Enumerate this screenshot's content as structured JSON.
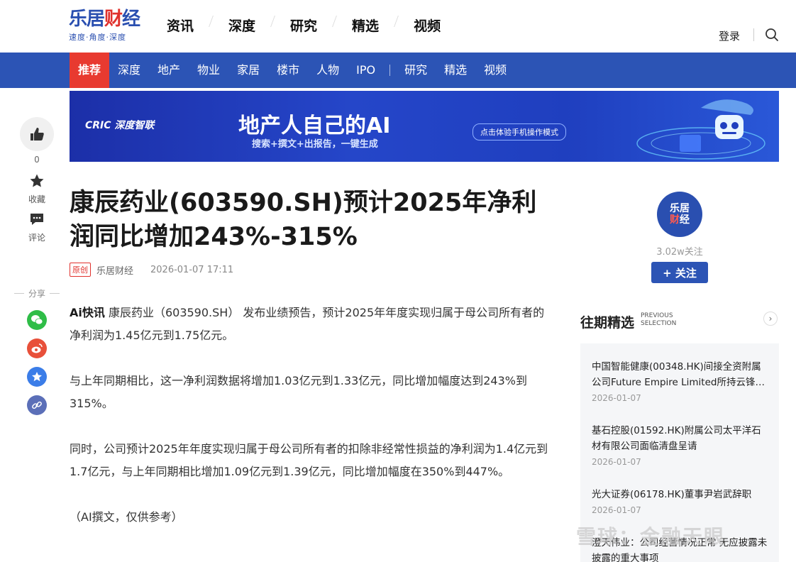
{
  "header": {
    "logo_main_a": "乐居",
    "logo_main_b": "财",
    "logo_main_c": "经",
    "logo_sub": "速度·角度·深度",
    "nav": [
      "资讯",
      "深度",
      "研究",
      "精选",
      "视频"
    ],
    "login": "登录"
  },
  "subnav": {
    "active": "推荐",
    "items_a": [
      "深度",
      "地产",
      "物业",
      "家居",
      "楼市",
      "人物",
      "IPO"
    ],
    "items_b": [
      "研究",
      "精选",
      "视频"
    ]
  },
  "banner": {
    "brand": "CRIC 深度智联",
    "title": "地产人自己的AI",
    "subtitle": "搜索+撰文+出报告，一键生成",
    "cta": "点击体验手机操作模式"
  },
  "rail": {
    "like_count": "0",
    "favorite_label": "收藏",
    "comment_label": "评论",
    "share_label": "分享"
  },
  "article": {
    "title": "康辰药业(603590.SH)预计2025年净利润同比增加243%-315%",
    "tag": "原创",
    "source": "乐居财经",
    "datetime": "2026-01-07 17:11",
    "ai_label": "Ai快讯",
    "p1": " 康辰药业（603590.SH） 发布业绩预告，预计2025年年度实现归属于母公司所有者的净利润为1.45亿元到1.75亿元。",
    "p2": "与上年同期相比，这一净利润数据将增加1.03亿元到1.33亿元，同比增加幅度达到243%到315%。",
    "p3": "同时，公司预计2025年年度实现归属于母公司所有者的扣除非经常性损益的净利润为1.4亿元到1.7亿元，与上年同期相比增加1.09亿元到1.39亿元，同比增加幅度在350%到447%。",
    "p4": "（AI撰文，仅供参考）"
  },
  "author": {
    "avatar_a": "乐居",
    "avatar_b": "财",
    "avatar_c": "经",
    "followers": "3.02w关注",
    "follow_label": "+ 关注"
  },
  "past": {
    "title": "往期精选",
    "en_line1": "PREVIOUS",
    "en_line2": "SELECTION",
    "arrow": "›",
    "items": [
      {
        "title": "中国智能健康(00348.HK)间接全资附属公司Future Empire Limited所持云锋…",
        "date": "2026-01-07"
      },
      {
        "title": "基石控股(01592.HK)附属公司太平洋石材有限公司面临清盘呈请",
        "date": "2026-01-07"
      },
      {
        "title": "光大证券(06178.HK)董事尹岩武辞职",
        "date": "2026-01-07"
      },
      {
        "title": "澄天伟业：公司经营情况正常 无应披露未披露的重大事项",
        "date": ""
      }
    ]
  },
  "watermark": "雪球：金融天眼"
}
